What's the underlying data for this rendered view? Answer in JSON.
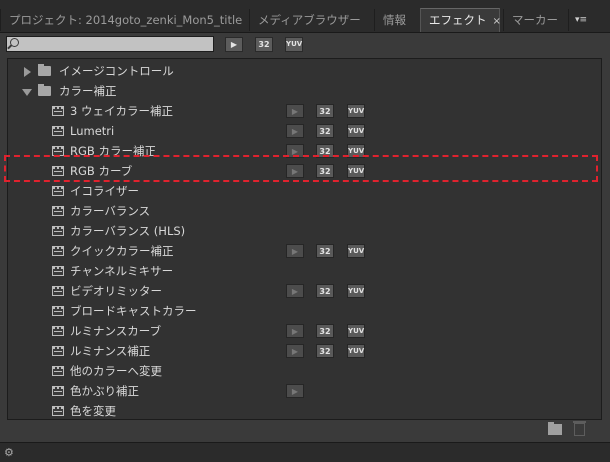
{
  "tabs": [
    {
      "label": "プロジェクト: 2014goto_zenki_Mon5_title",
      "active": false
    },
    {
      "label": "メディアブラウザー",
      "active": false
    },
    {
      "label": "情報",
      "active": false
    },
    {
      "label": "エフェクト",
      "active": true,
      "close": "×"
    },
    {
      "label": "マーカー",
      "active": false
    }
  ],
  "panel_menu": {
    "label": "▾≡"
  },
  "search": {
    "value": "",
    "placeholder": ""
  },
  "filter_buttons": {
    "accel": "▶",
    "b32": "32",
    "yuv": "YUV"
  },
  "tree": {
    "folder_image_control": "イメージコントロール",
    "folder_color": "カラー補正",
    "items": [
      {
        "label": "3 ウェイカラー補正",
        "accel": true,
        "b32": true,
        "yuv": true
      },
      {
        "label": "Lumetri",
        "accel": true,
        "b32": true,
        "yuv": true
      },
      {
        "label": "RGB カラー補正",
        "accel": true,
        "b32": true,
        "yuv": true
      },
      {
        "label": "RGB カーブ",
        "accel": true,
        "b32": true,
        "yuv": true
      },
      {
        "label": "イコライザー",
        "accel": false,
        "b32": false,
        "yuv": false
      },
      {
        "label": "カラーバランス",
        "accel": false,
        "b32": false,
        "yuv": false
      },
      {
        "label": "カラーバランス (HLS)",
        "accel": false,
        "b32": false,
        "yuv": false
      },
      {
        "label": "クイックカラー補正",
        "accel": true,
        "b32": true,
        "yuv": true
      },
      {
        "label": "チャンネルミキサー",
        "accel": false,
        "b32": false,
        "yuv": false
      },
      {
        "label": "ビデオリミッター",
        "accel": true,
        "b32": true,
        "yuv": true
      },
      {
        "label": "ブロードキャストカラー",
        "accel": false,
        "b32": false,
        "yuv": false
      },
      {
        "label": "ルミナンスカーブ",
        "accel": true,
        "b32": true,
        "yuv": true
      },
      {
        "label": "ルミナンス補正",
        "accel": true,
        "b32": true,
        "yuv": true
      },
      {
        "label": "他のカラーへ変更",
        "accel": false,
        "b32": false,
        "yuv": false
      },
      {
        "label": "色かぶり補正",
        "accel": true,
        "b32": false,
        "yuv": false
      },
      {
        "label": "色を変更",
        "accel": false,
        "b32": false,
        "yuv": false
      }
    ]
  },
  "highlight_color": "#e0222e"
}
